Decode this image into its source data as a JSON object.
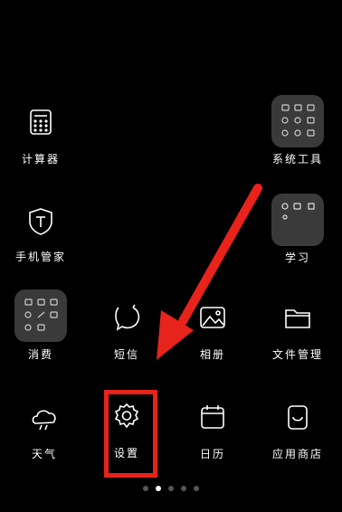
{
  "apps": {
    "calculator": {
      "label": "计算器",
      "icon": "calculator-icon"
    },
    "system_tools": {
      "label": "系统工具",
      "icon": "system-tools-folder"
    },
    "phone_manager": {
      "label": "手机管家",
      "icon": "shield-t-icon"
    },
    "study": {
      "label": "学习",
      "icon": "study-folder"
    },
    "consumption": {
      "label": "消费",
      "icon": "consumption-folder"
    },
    "messages": {
      "label": "短信",
      "icon": "message-bubble-icon"
    },
    "gallery": {
      "label": "相册",
      "icon": "photo-icon"
    },
    "file_manager": {
      "label": "文件管理",
      "icon": "folder-icon"
    },
    "weather": {
      "label": "天气",
      "icon": "cloud-weather-icon"
    },
    "settings": {
      "label": "设置",
      "icon": "gear-icon"
    },
    "calendar": {
      "label": "日历",
      "icon": "calendar-icon"
    },
    "app_store": {
      "label": "应用商店",
      "icon": "shopping-bag-icon"
    }
  },
  "page_indicator": {
    "count": 5,
    "active_index": 1
  },
  "annotation": {
    "arrow_color": "#e8231b",
    "highlight_color": "#e8231b",
    "highlight_target": "settings"
  }
}
